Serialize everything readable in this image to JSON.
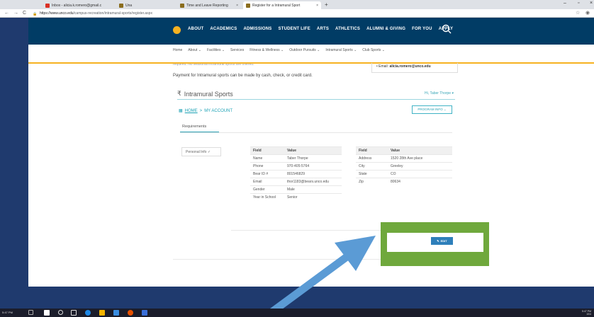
{
  "browser": {
    "tabs": [
      {
        "label": "Inbox - alicia.k.romero@gmail.c",
        "fav_color": "#d93025"
      },
      {
        "label": "Una",
        "fav_color": "#8a6d1e"
      },
      {
        "label": "Time and Leave Reporting",
        "fav_color": "#8a6d1e"
      },
      {
        "label": "Register for a Intramural Sport",
        "fav_color": "#8a6d1e"
      }
    ],
    "url_host": "https://www.unco.edu",
    "url_path": "/campus-recreation/intramural-sports/register.aspx"
  },
  "site": {
    "nav": [
      "ABOUT",
      "ACADEMICS",
      "ADMISSIONS",
      "STUDENT LIFE",
      "ARTS",
      "ATHLETICS",
      "ALUMNI & GIVING",
      "FOR YOU",
      "APPLY"
    ],
    "subnav": [
      "Home",
      "About ⌄",
      "Facilities ⌄",
      "Services",
      "Fitness & Wellness ⌄",
      "Outdoor Pursuits ⌄",
      "Intramural Sports ⌄",
      "Club Sports ⌄"
    ],
    "cut_text": "required. No seasonal intramural sports are offered.",
    "contact_email_label": "Email:",
    "contact_email": "alicia.romero@unco.edu",
    "payment_text": "Payment for Intramural sports can be made by cash, check, or credit card."
  },
  "im": {
    "title": "Intramural Sports",
    "greeting": "Hi, Taber Thorpe ▾",
    "crumb_home": "HOME",
    "crumb_sep": ">",
    "crumb_current": "MY ACCOUNT",
    "program_info": "PROGRAM INFO ⌄",
    "requirements_tab": "Requirements",
    "personal_info_tab": "Personal Info ✓",
    "edit_label": "EDIT"
  },
  "table1": {
    "headers": [
      "Field",
      "Value"
    ],
    "rows": [
      [
        "Name",
        "Taber Thorpe"
      ],
      [
        "Phone",
        "970-405-5764"
      ],
      [
        "Bear ID #",
        "801546829"
      ],
      [
        "Email",
        "thor1183@bears.unco.edu"
      ],
      [
        "Gender",
        "Male"
      ],
      [
        "Year in School",
        "Senior"
      ]
    ]
  },
  "table2": {
    "headers": [
      "Field",
      "Value"
    ],
    "rows": [
      [
        "Address",
        "1520 28th Ave place"
      ],
      [
        "City",
        "Greeley"
      ],
      [
        "State",
        "CO"
      ],
      [
        "Zip",
        "80634"
      ]
    ]
  },
  "taskbar": {
    "time": "5:47 PM",
    "right_time": "5:47 PM",
    "right_date": "10/4"
  },
  "colors": {
    "nav_bg": "#013c65",
    "gold": "#f6b221",
    "teal": "#2aa1b4",
    "highlight": "#6fa83c",
    "arrow": "#5b9bd5"
  }
}
